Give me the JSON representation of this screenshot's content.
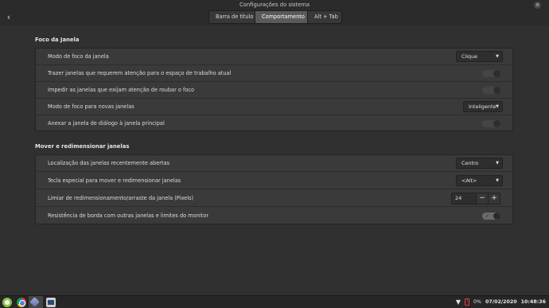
{
  "window": {
    "title": "Configurações do sistema",
    "back_glyph": "‹",
    "close_glyph": "✕"
  },
  "tabs": [
    {
      "label": "Barra de título",
      "active": false
    },
    {
      "label": "Comportamento",
      "active": true
    },
    {
      "label": "Alt + Tab",
      "active": false
    }
  ],
  "section1": {
    "title": "Foco da Janela",
    "rows": [
      {
        "label": "Modo de foco da janela",
        "control": "dropdown",
        "value": "Clique"
      },
      {
        "label": "Trazer janelas que requerem atenção para o espaço de trabalho atual",
        "control": "toggle",
        "on": false
      },
      {
        "label": "Impedir as janelas que exijam atenção de roubar o foco",
        "control": "toggle",
        "on": false
      },
      {
        "label": "Modo de foco para novas janelas",
        "control": "dropdown",
        "value": "Inteligente"
      },
      {
        "label": "Anexar a janela de diálogo à janela principal",
        "control": "toggle",
        "on": false
      }
    ]
  },
  "section2": {
    "title": "Mover e redimensionar janelas",
    "rows": [
      {
        "label": "Localização das janelas recentemente abertas",
        "control": "dropdown",
        "value": "Centro"
      },
      {
        "label": "Tecla especial para mover e redimensionar janelas",
        "control": "dropdown",
        "value": "<Alt>"
      },
      {
        "label": "Limiar de redimensionamento/arraste da janela (Pixels)",
        "control": "spin",
        "value": "24",
        "minus": "−",
        "plus": "+"
      },
      {
        "label": "Resistência de borda com outras janelas e limites do monitor",
        "control": "toggle",
        "on": true
      }
    ]
  },
  "taskbar": {
    "icons": [
      "menu-icon",
      "chrome-icon",
      "settings-icon",
      "terminal-icon"
    ],
    "tray": {
      "network_glyph": "▼",
      "battery_percent": "0%",
      "date": "07/02/2020",
      "time": "10:48:36"
    }
  },
  "colors": {
    "background": "#303030",
    "panel": "#3a3a3a",
    "active_tab": "#5a5a5a",
    "toggle_on": "#6a6a6a"
  }
}
